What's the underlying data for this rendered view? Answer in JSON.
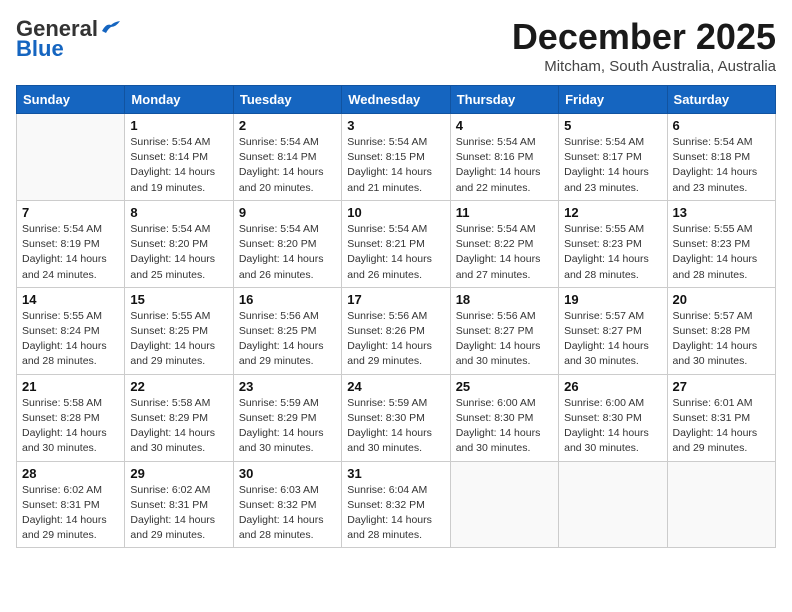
{
  "logo": {
    "general": "General",
    "blue": "Blue"
  },
  "title": "December 2025",
  "subtitle": "Mitcham, South Australia, Australia",
  "days_header": [
    "Sunday",
    "Monday",
    "Tuesday",
    "Wednesday",
    "Thursday",
    "Friday",
    "Saturday"
  ],
  "weeks": [
    [
      {
        "day": "",
        "sunrise": "",
        "sunset": "",
        "daylight": ""
      },
      {
        "day": "1",
        "sunrise": "Sunrise: 5:54 AM",
        "sunset": "Sunset: 8:14 PM",
        "daylight": "Daylight: 14 hours and 19 minutes."
      },
      {
        "day": "2",
        "sunrise": "Sunrise: 5:54 AM",
        "sunset": "Sunset: 8:14 PM",
        "daylight": "Daylight: 14 hours and 20 minutes."
      },
      {
        "day": "3",
        "sunrise": "Sunrise: 5:54 AM",
        "sunset": "Sunset: 8:15 PM",
        "daylight": "Daylight: 14 hours and 21 minutes."
      },
      {
        "day": "4",
        "sunrise": "Sunrise: 5:54 AM",
        "sunset": "Sunset: 8:16 PM",
        "daylight": "Daylight: 14 hours and 22 minutes."
      },
      {
        "day": "5",
        "sunrise": "Sunrise: 5:54 AM",
        "sunset": "Sunset: 8:17 PM",
        "daylight": "Daylight: 14 hours and 23 minutes."
      },
      {
        "day": "6",
        "sunrise": "Sunrise: 5:54 AM",
        "sunset": "Sunset: 8:18 PM",
        "daylight": "Daylight: 14 hours and 23 minutes."
      }
    ],
    [
      {
        "day": "7",
        "sunrise": "Sunrise: 5:54 AM",
        "sunset": "Sunset: 8:19 PM",
        "daylight": "Daylight: 14 hours and 24 minutes."
      },
      {
        "day": "8",
        "sunrise": "Sunrise: 5:54 AM",
        "sunset": "Sunset: 8:20 PM",
        "daylight": "Daylight: 14 hours and 25 minutes."
      },
      {
        "day": "9",
        "sunrise": "Sunrise: 5:54 AM",
        "sunset": "Sunset: 8:20 PM",
        "daylight": "Daylight: 14 hours and 26 minutes."
      },
      {
        "day": "10",
        "sunrise": "Sunrise: 5:54 AM",
        "sunset": "Sunset: 8:21 PM",
        "daylight": "Daylight: 14 hours and 26 minutes."
      },
      {
        "day": "11",
        "sunrise": "Sunrise: 5:54 AM",
        "sunset": "Sunset: 8:22 PM",
        "daylight": "Daylight: 14 hours and 27 minutes."
      },
      {
        "day": "12",
        "sunrise": "Sunrise: 5:55 AM",
        "sunset": "Sunset: 8:23 PM",
        "daylight": "Daylight: 14 hours and 28 minutes."
      },
      {
        "day": "13",
        "sunrise": "Sunrise: 5:55 AM",
        "sunset": "Sunset: 8:23 PM",
        "daylight": "Daylight: 14 hours and 28 minutes."
      }
    ],
    [
      {
        "day": "14",
        "sunrise": "Sunrise: 5:55 AM",
        "sunset": "Sunset: 8:24 PM",
        "daylight": "Daylight: 14 hours and 28 minutes."
      },
      {
        "day": "15",
        "sunrise": "Sunrise: 5:55 AM",
        "sunset": "Sunset: 8:25 PM",
        "daylight": "Daylight: 14 hours and 29 minutes."
      },
      {
        "day": "16",
        "sunrise": "Sunrise: 5:56 AM",
        "sunset": "Sunset: 8:25 PM",
        "daylight": "Daylight: 14 hours and 29 minutes."
      },
      {
        "day": "17",
        "sunrise": "Sunrise: 5:56 AM",
        "sunset": "Sunset: 8:26 PM",
        "daylight": "Daylight: 14 hours and 29 minutes."
      },
      {
        "day": "18",
        "sunrise": "Sunrise: 5:56 AM",
        "sunset": "Sunset: 8:27 PM",
        "daylight": "Daylight: 14 hours and 30 minutes."
      },
      {
        "day": "19",
        "sunrise": "Sunrise: 5:57 AM",
        "sunset": "Sunset: 8:27 PM",
        "daylight": "Daylight: 14 hours and 30 minutes."
      },
      {
        "day": "20",
        "sunrise": "Sunrise: 5:57 AM",
        "sunset": "Sunset: 8:28 PM",
        "daylight": "Daylight: 14 hours and 30 minutes."
      }
    ],
    [
      {
        "day": "21",
        "sunrise": "Sunrise: 5:58 AM",
        "sunset": "Sunset: 8:28 PM",
        "daylight": "Daylight: 14 hours and 30 minutes."
      },
      {
        "day": "22",
        "sunrise": "Sunrise: 5:58 AM",
        "sunset": "Sunset: 8:29 PM",
        "daylight": "Daylight: 14 hours and 30 minutes."
      },
      {
        "day": "23",
        "sunrise": "Sunrise: 5:59 AM",
        "sunset": "Sunset: 8:29 PM",
        "daylight": "Daylight: 14 hours and 30 minutes."
      },
      {
        "day": "24",
        "sunrise": "Sunrise: 5:59 AM",
        "sunset": "Sunset: 8:30 PM",
        "daylight": "Daylight: 14 hours and 30 minutes."
      },
      {
        "day": "25",
        "sunrise": "Sunrise: 6:00 AM",
        "sunset": "Sunset: 8:30 PM",
        "daylight": "Daylight: 14 hours and 30 minutes."
      },
      {
        "day": "26",
        "sunrise": "Sunrise: 6:00 AM",
        "sunset": "Sunset: 8:30 PM",
        "daylight": "Daylight: 14 hours and 30 minutes."
      },
      {
        "day": "27",
        "sunrise": "Sunrise: 6:01 AM",
        "sunset": "Sunset: 8:31 PM",
        "daylight": "Daylight: 14 hours and 29 minutes."
      }
    ],
    [
      {
        "day": "28",
        "sunrise": "Sunrise: 6:02 AM",
        "sunset": "Sunset: 8:31 PM",
        "daylight": "Daylight: 14 hours and 29 minutes."
      },
      {
        "day": "29",
        "sunrise": "Sunrise: 6:02 AM",
        "sunset": "Sunset: 8:31 PM",
        "daylight": "Daylight: 14 hours and 29 minutes."
      },
      {
        "day": "30",
        "sunrise": "Sunrise: 6:03 AM",
        "sunset": "Sunset: 8:32 PM",
        "daylight": "Daylight: 14 hours and 28 minutes."
      },
      {
        "day": "31",
        "sunrise": "Sunrise: 6:04 AM",
        "sunset": "Sunset: 8:32 PM",
        "daylight": "Daylight: 14 hours and 28 minutes."
      },
      {
        "day": "",
        "sunrise": "",
        "sunset": "",
        "daylight": ""
      },
      {
        "day": "",
        "sunrise": "",
        "sunset": "",
        "daylight": ""
      },
      {
        "day": "",
        "sunrise": "",
        "sunset": "",
        "daylight": ""
      }
    ]
  ]
}
